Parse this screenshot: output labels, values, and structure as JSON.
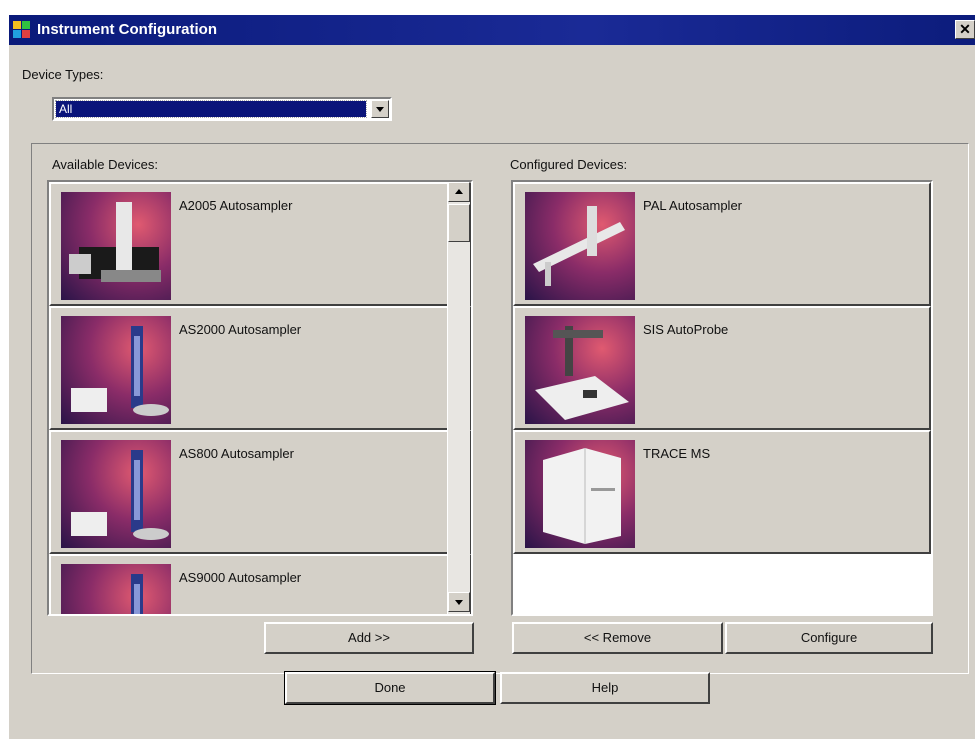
{
  "window": {
    "title": "Instrument Configuration",
    "close": "✕"
  },
  "device_types": {
    "label": "Device Types:",
    "selected": "All"
  },
  "available": {
    "label": "Available Devices:",
    "items": [
      {
        "name": "A2005 Autosampler"
      },
      {
        "name": "AS2000 Autosampler"
      },
      {
        "name": "AS800 Autosampler"
      },
      {
        "name": "AS9000 Autosampler"
      }
    ]
  },
  "configured": {
    "label": "Configured Devices:",
    "items": [
      {
        "name": "PAL Autosampler"
      },
      {
        "name": "SIS AutoProbe"
      },
      {
        "name": "TRACE MS"
      }
    ]
  },
  "buttons": {
    "add": "Add >>",
    "remove": "<< Remove",
    "configure": "Configure",
    "done": "Done",
    "help": "Help"
  },
  "colors": {
    "titlebar": "#0a1a7a",
    "face": "#d4d0c8",
    "selection": "#0a147a"
  }
}
